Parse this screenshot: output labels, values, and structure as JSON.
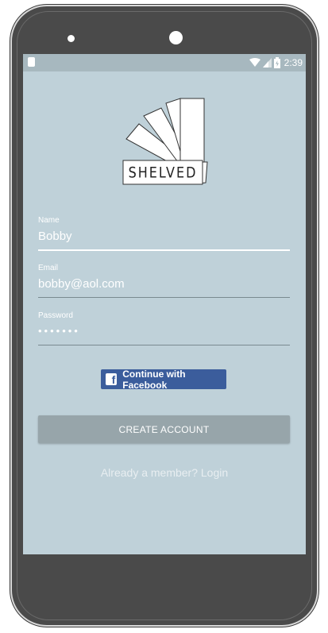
{
  "status_bar": {
    "time": "2:39",
    "icons": [
      "notification-icon",
      "wifi-icon",
      "signal-icon",
      "battery-icon"
    ]
  },
  "logo": {
    "text": "SHELVED"
  },
  "form": {
    "name": {
      "label": "Name",
      "value": "Bobby"
    },
    "email": {
      "label": "Email",
      "value": "bobby@aol.com"
    },
    "password": {
      "label": "Password",
      "value": "•••••••"
    }
  },
  "facebook_button": {
    "label": "Continue with Facebook",
    "icon": "facebook-icon"
  },
  "create_button": {
    "label": "CREATE ACCOUNT"
  },
  "login_link": {
    "label": "Already a member? Login"
  },
  "colors": {
    "screen_bg": "#bfd1d9",
    "facebook_blue": "#3b5d9c",
    "button_gray": "#97a5aa",
    "device_body": "#4a4a4a"
  }
}
